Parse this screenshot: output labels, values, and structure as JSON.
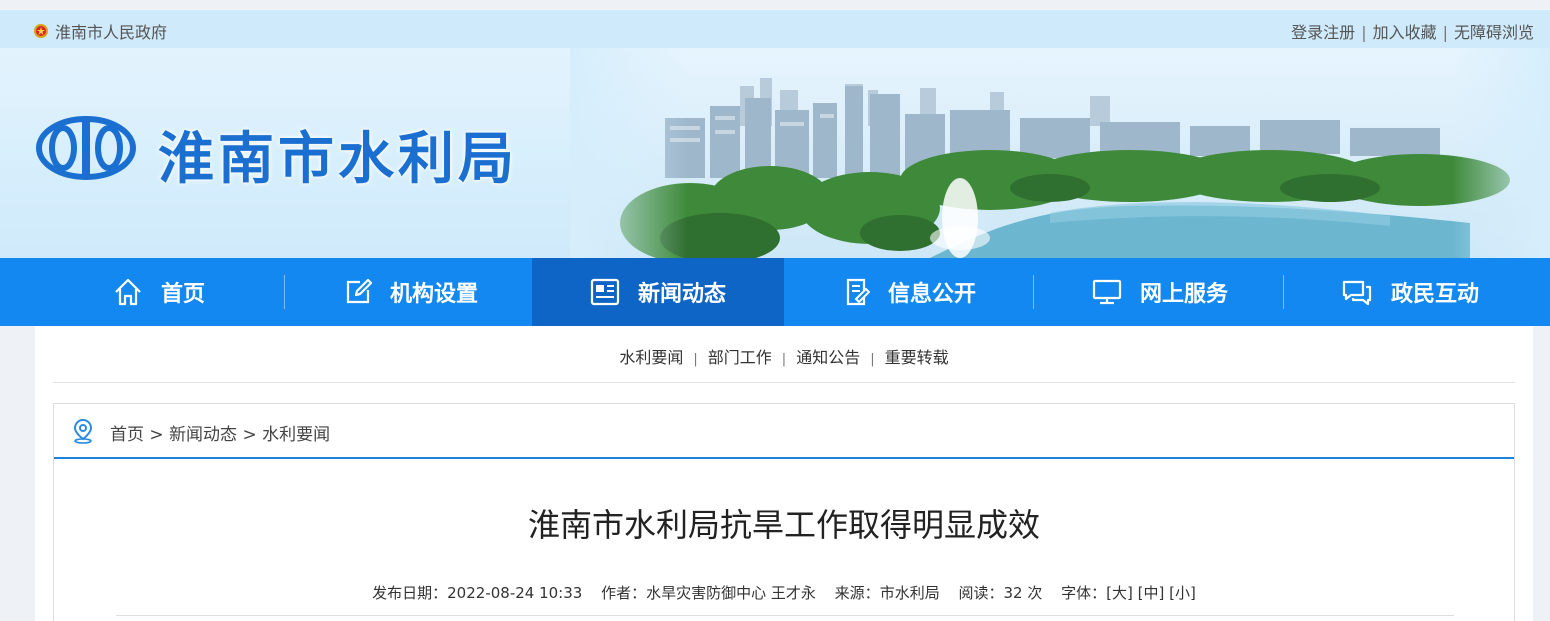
{
  "topbar": {
    "gov_name": "淮南市人民政府",
    "links": [
      "登录注册",
      "加入收藏",
      "无障碍浏览"
    ]
  },
  "banner": {
    "site_name": "淮南市水利局"
  },
  "nav": {
    "items": [
      {
        "label": "首页",
        "icon": "home-icon"
      },
      {
        "label": "机构设置",
        "icon": "edit-icon"
      },
      {
        "label": "新闻动态",
        "icon": "news-icon",
        "active": true
      },
      {
        "label": "信息公开",
        "icon": "document-icon"
      },
      {
        "label": "网上服务",
        "icon": "monitor-icon"
      },
      {
        "label": "政民互动",
        "icon": "chat-icon"
      }
    ]
  },
  "subnav": {
    "items": [
      "水利要闻",
      "部门工作",
      "通知公告",
      "重要转载"
    ]
  },
  "breadcrumb": {
    "items": [
      "首页",
      "新闻动态",
      "水利要闻"
    ],
    "separator": ">"
  },
  "article": {
    "title": "淮南市水利局抗旱工作取得明显成效",
    "publish_label": "发布日期：",
    "publish_date": "2022-08-24 10:33",
    "author_label": "作者：",
    "author": "水旱灾害防御中心 王才永",
    "source_label": "来源：",
    "source": "市水利局",
    "reads_label": "阅读：",
    "reads": "32 次",
    "font_label": "字体：",
    "font_sizes": [
      "[大]",
      "[中]",
      "[小]"
    ]
  },
  "colors": {
    "nav_bg": "#1288f0",
    "nav_active": "#0f65c5",
    "brand_blue": "#1a6fd1"
  }
}
